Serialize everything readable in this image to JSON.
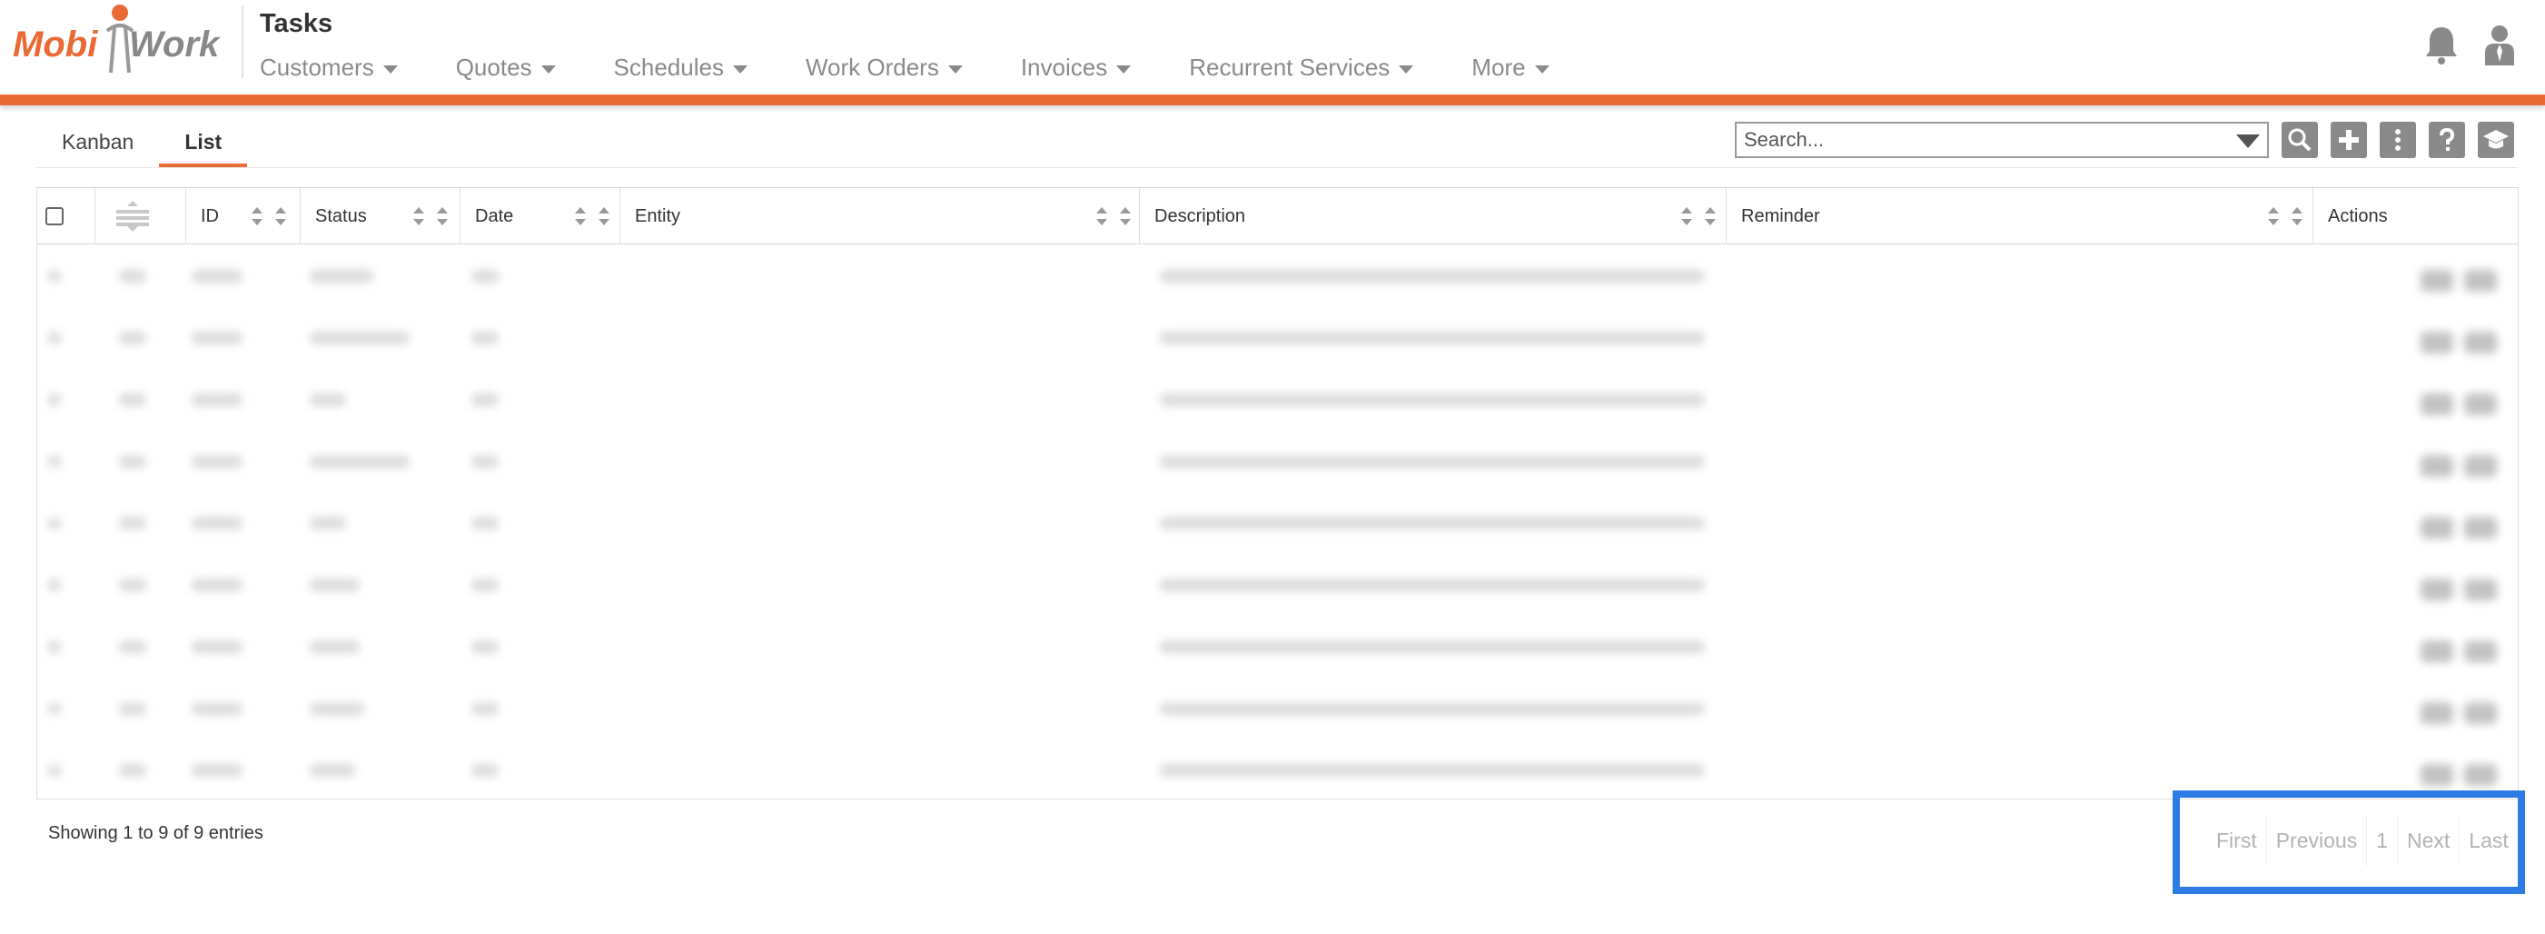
{
  "header": {
    "logo_text": "MobiWork",
    "page_title": "Tasks",
    "nav": [
      {
        "label": "Customers"
      },
      {
        "label": "Quotes"
      },
      {
        "label": "Schedules"
      },
      {
        "label": "Work Orders"
      },
      {
        "label": "Invoices"
      },
      {
        "label": "Recurrent Services"
      },
      {
        "label": "More"
      }
    ],
    "icons": [
      "bell-icon",
      "user-icon"
    ]
  },
  "tabs": [
    {
      "label": "Kanban",
      "active": false
    },
    {
      "label": "List",
      "active": true
    }
  ],
  "toolbar": {
    "search_placeholder": "Search...",
    "buttons": [
      "search-icon",
      "plus-icon",
      "more-vertical-icon",
      "help-icon",
      "graduation-cap-icon"
    ]
  },
  "table": {
    "columns": [
      "ID",
      "Status",
      "Date",
      "Entity",
      "Description",
      "Reminder",
      "Actions"
    ],
    "row_count": 9
  },
  "footer": {
    "info": "Showing 1 to 9 of 9 entries",
    "pagination": {
      "first": "First",
      "previous": "Previous",
      "page": "1",
      "next": "Next",
      "last": "Last"
    }
  },
  "colors": {
    "accent": "#ea6a35",
    "highlight": "#2d7be5",
    "icon_gray": "#8a8a8a"
  }
}
